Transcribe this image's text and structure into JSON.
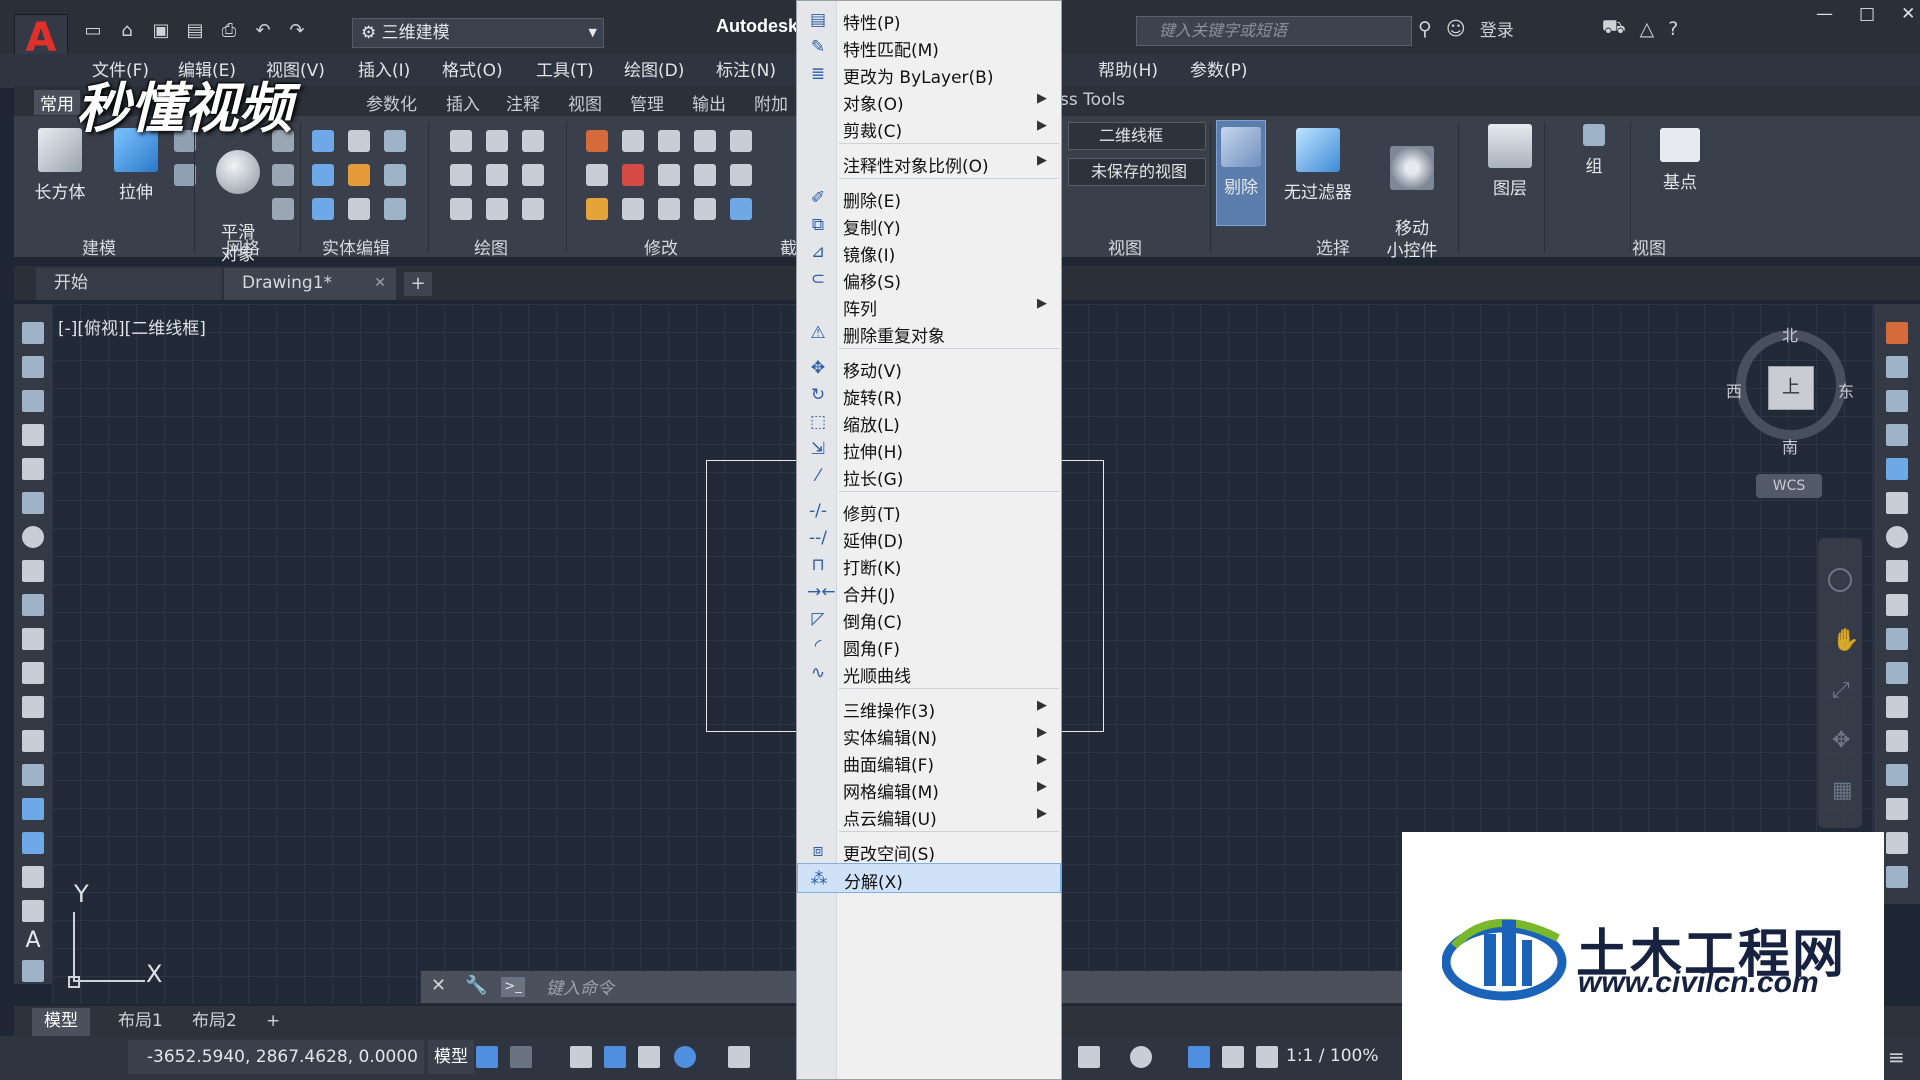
{
  "title_bar": {
    "workspace": "三维建模",
    "app_title": "Autodesk",
    "search_placeholder": "键入关键字或短语",
    "login": "登录"
  },
  "menubar": [
    "文件(F)",
    "编辑(E)",
    "视图(V)",
    "插入(I)",
    "格式(O)",
    "工具(T)",
    "绘图(D)",
    "标注(N)",
    "帮助(H)",
    "参数(P)"
  ],
  "ribbon_tabs": [
    "常用",
    "参数化",
    "插入",
    "注释",
    "视图",
    "管理",
    "输出",
    "附加",
    "ss Tools"
  ],
  "ribbon": {
    "buttons": {
      "box": "长方体",
      "extrude": "拉伸",
      "smooth": "平滑\n对象",
      "visual_style": "二维线框",
      "view": "未保存的视图",
      "cull": "剔除",
      "no_filter": "无过滤器",
      "move_gizmo": "移动\n小控件",
      "layers": "图层",
      "group": "组",
      "base_point": "基点"
    },
    "panels": [
      "建模",
      "网格",
      "实体编辑",
      "绘图",
      "修改",
      "截",
      "视图",
      "选择",
      "视图"
    ]
  },
  "doc_tabs": [
    "开始",
    "Drawing1*"
  ],
  "viewport_label": "[-][俯视][二维线框]",
  "viewcube": {
    "north": "北",
    "south": "南",
    "east": "东",
    "west": "西",
    "face": "上",
    "wcs": "WCS"
  },
  "ucs": {
    "x": "X",
    "y": "Y"
  },
  "command_line": {
    "placeholder": "键入命令"
  },
  "layout_tabs": [
    "模型",
    "布局1",
    "布局2"
  ],
  "status": {
    "coords": "-3652.5940, 2867.4628, 0.0000",
    "model": "模型",
    "scale": "1:1 / 100%"
  },
  "context_menu": {
    "items": [
      {
        "label": "特性(P)",
        "icon": "properties-icon"
      },
      {
        "label": "特性匹配(M)",
        "icon": "match-properties-icon"
      },
      {
        "label": "更改为 ByLayer(B)",
        "icon": "bylayer-icon"
      },
      {
        "label": "对象(O)",
        "submenu": true
      },
      {
        "label": "剪裁(C)",
        "submenu": true
      },
      {
        "separator": true
      },
      {
        "label": "注释性对象比例(O)",
        "submenu": true
      },
      {
        "separator": true
      },
      {
        "label": "删除(E)",
        "icon": "erase-icon"
      },
      {
        "label": "复制(Y)",
        "icon": "copy-icon"
      },
      {
        "label": "镜像(I)",
        "icon": "mirror-icon"
      },
      {
        "label": "偏移(S)",
        "icon": "offset-icon"
      },
      {
        "label": "阵列",
        "submenu": true
      },
      {
        "label": "删除重复对象",
        "icon": "overkill-icon"
      },
      {
        "separator": true
      },
      {
        "label": "移动(V)",
        "icon": "move-icon"
      },
      {
        "label": "旋转(R)",
        "icon": "rotate-icon"
      },
      {
        "label": "缩放(L)",
        "icon": "scale-icon"
      },
      {
        "label": "拉伸(H)",
        "icon": "stretch-icon"
      },
      {
        "label": "拉长(G)",
        "icon": "lengthen-icon"
      },
      {
        "separator": true
      },
      {
        "label": "修剪(T)",
        "icon": "trim-icon"
      },
      {
        "label": "延伸(D)",
        "icon": "extend-icon"
      },
      {
        "label": "打断(K)",
        "icon": "break-icon"
      },
      {
        "label": "合并(J)",
        "icon": "join-icon"
      },
      {
        "label": "倒角(C)",
        "icon": "chamfer-icon"
      },
      {
        "label": "圆角(F)",
        "icon": "fillet-icon"
      },
      {
        "label": "光顺曲线",
        "icon": "blend-curves-icon"
      },
      {
        "separator": true
      },
      {
        "label": "三维操作(3)",
        "submenu": true
      },
      {
        "label": "实体编辑(N)",
        "submenu": true
      },
      {
        "label": "曲面编辑(F)",
        "submenu": true
      },
      {
        "label": "网格编辑(M)",
        "submenu": true
      },
      {
        "label": "点云编辑(U)",
        "submenu": true
      },
      {
        "separator": true
      },
      {
        "label": "更改空间(S)",
        "icon": "change-space-icon"
      },
      {
        "label": "分解(X)",
        "icon": "explode-icon",
        "highlighted": true
      }
    ]
  },
  "watermarks": {
    "video": "秒懂视频",
    "site_name": "土木工程网",
    "site_url": "www.civilcn.com"
  },
  "colors": {
    "canvas_bg": "#222a38",
    "grid": "#2d3647",
    "menu_highlight": "#cfe2f8",
    "app_red": "#e0302b"
  }
}
